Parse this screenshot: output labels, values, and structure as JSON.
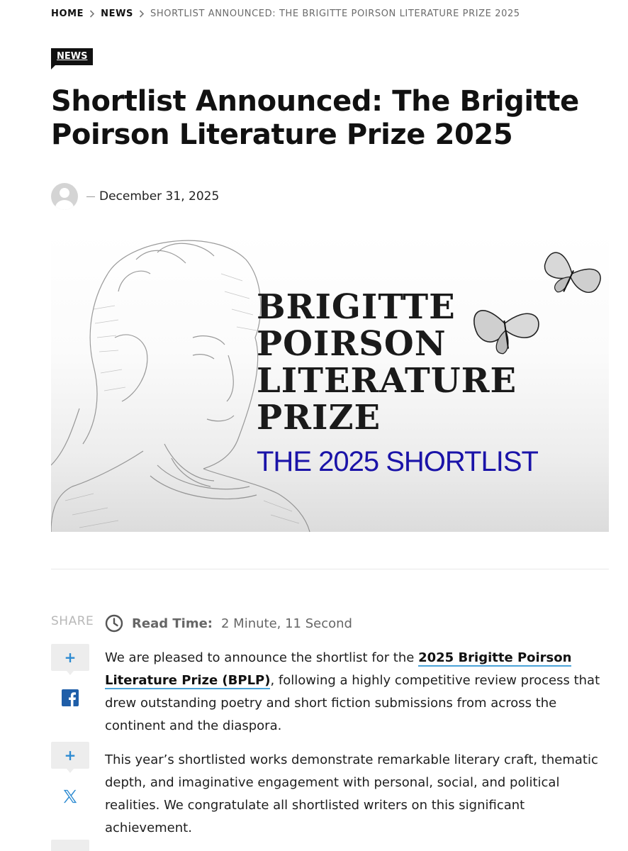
{
  "breadcrumb": {
    "home": "HOME",
    "section": "NEWS",
    "current": "SHORTLIST ANNOUNCED: THE BRIGITTE POIRSON LITERATURE PRIZE 2025"
  },
  "post": {
    "category": "NEWS",
    "title": "Shortlist Announced: The Brigitte Poirson Literature Prize 2025",
    "date": "December 31, 2025"
  },
  "hero": {
    "title_lines": [
      "BRIGITTE",
      "POIRSON",
      "LITERATURE",
      "PRIZE"
    ],
    "subtitle": "THE 2025 SHORTLIST",
    "title_color": "#1a1a1a",
    "subtitle_color": "#1a13a8"
  },
  "share": {
    "label": "SHARE",
    "plus": "+",
    "icons": [
      "facebook-icon",
      "x-icon"
    ]
  },
  "read_time": {
    "label": "Read Time:",
    "value": "2 Minute, 11 Second"
  },
  "body": {
    "p1_before": "We are pleased to announce the shortlist for the ",
    "p1_link": "2025 Brigitte Poirson Literature Prize (BPLP)",
    "p1_after": ", following a highly competitive review process that drew outstanding poetry and short fiction submissions from across the continent and the diaspora.",
    "p2": "This year’s shortlisted works demonstrate remarkable literary craft, thematic depth, and imaginative engagement with personal, social, and political realities. We congratulate all shortlisted writers on this significant achievement."
  },
  "colors": {
    "accent": "#2d8bd2",
    "link_underline": "#4aa3d8",
    "badge_bg": "#111111"
  }
}
